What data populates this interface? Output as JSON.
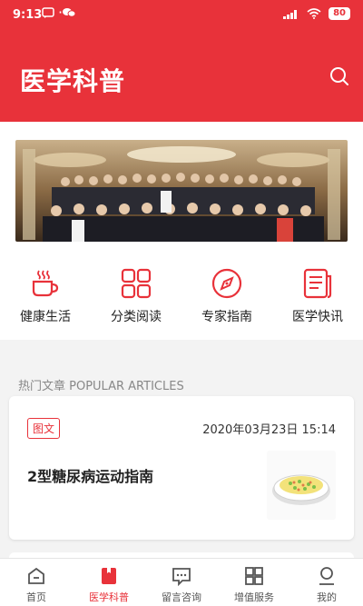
{
  "status": {
    "time": "9:13",
    "battery": "80"
  },
  "header": {
    "title": "医学科普"
  },
  "features": [
    {
      "label": "健康生活",
      "icon": "coffee-cup-icon"
    },
    {
      "label": "分类阅读",
      "icon": "grid-icon"
    },
    {
      "label": "专家指南",
      "icon": "compass-icon"
    },
    {
      "label": "医学快讯",
      "icon": "news-icon"
    }
  ],
  "section": {
    "title": "热门文章 POPULAR ARTICLES"
  },
  "article": {
    "tag": "图文",
    "date": "2020年03月23日 15:14",
    "title": "2型糖尿病运动指南"
  },
  "tabs": [
    {
      "label": "首页",
      "icon": "home-icon",
      "active": false
    },
    {
      "label": "医学科普",
      "icon": "bookmark-icon",
      "active": true
    },
    {
      "label": "留言咨询",
      "icon": "message-icon",
      "active": false
    },
    {
      "label": "增值服务",
      "icon": "apps-icon",
      "active": false
    },
    {
      "label": "我的",
      "icon": "user-icon",
      "active": false
    }
  ],
  "colors": {
    "brand": "#e8323a"
  }
}
